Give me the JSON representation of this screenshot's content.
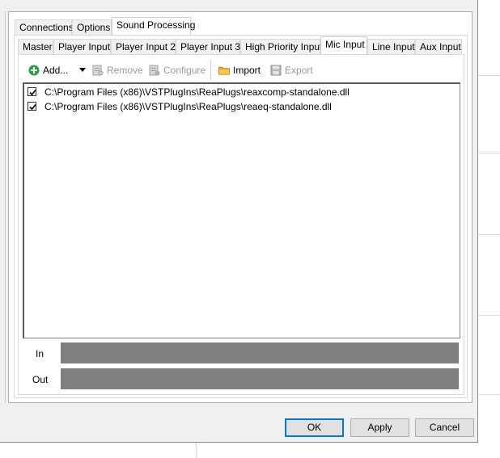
{
  "main_tabs": [
    {
      "label": "Connections",
      "active": false
    },
    {
      "label": "Options",
      "active": false
    },
    {
      "label": "Sound Processing",
      "active": true
    }
  ],
  "sub_tabs": [
    {
      "label": "Master",
      "active": false
    },
    {
      "label": "Player Input",
      "active": false
    },
    {
      "label": "Player Input 2",
      "active": false
    },
    {
      "label": "Player Input 3",
      "active": false
    },
    {
      "label": "High Priority Input",
      "active": false
    },
    {
      "label": "Mic Input",
      "active": true
    },
    {
      "label": "Line Input",
      "active": false
    },
    {
      "label": "Aux Input",
      "active": false
    }
  ],
  "toolbar": {
    "add_label": "Add...",
    "remove_label": "Remove",
    "configure_label": "Configure",
    "import_label": "Import",
    "export_label": "Export",
    "add_icon": "plus-circle-icon",
    "remove_icon": "remove-plugin-icon",
    "configure_icon": "configure-plugin-icon",
    "import_icon": "folder-icon",
    "export_icon": "save-icon"
  },
  "plugins": [
    {
      "path": "C:\\Program Files (x86)\\VSTPlugIns\\ReaPlugs\\reaxcomp-standalone.dll",
      "checked": true
    },
    {
      "path": "C:\\Program Files (x86)\\VSTPlugIns\\ReaPlugs\\reaeq-standalone.dll",
      "checked": true
    }
  ],
  "meters": {
    "in_label": "In",
    "out_label": "Out"
  },
  "buttons": {
    "ok": "OK",
    "apply": "Apply",
    "cancel": "Cancel"
  },
  "colors": {
    "accent": "#0078d7",
    "meter": "#808080",
    "add_icon": "#2e9e3e",
    "folder_icon": "#e8a825"
  }
}
